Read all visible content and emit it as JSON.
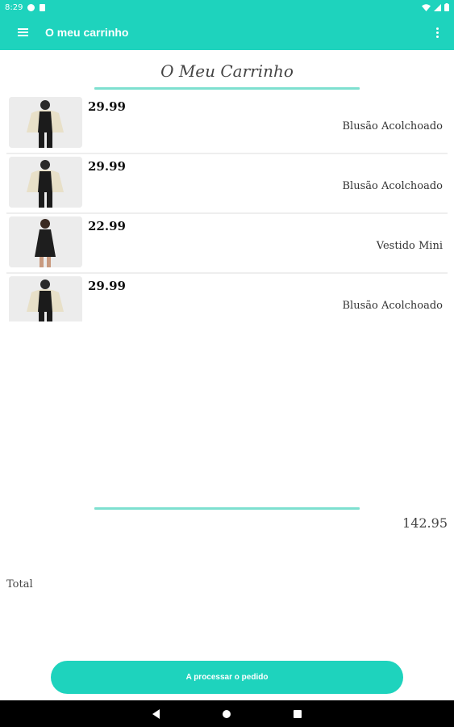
{
  "status_bar": {
    "time": "8:29",
    "icons": [
      "notification-icon",
      "sd-card-icon",
      "wifi-icon",
      "signal-icon",
      "battery-icon"
    ]
  },
  "app_bar": {
    "title": "O meu carrinho",
    "menu_icon": "hamburger-menu-icon",
    "overflow_icon": "more-vertical-icon"
  },
  "page": {
    "heading": "O Meu Carrinho"
  },
  "cart": {
    "items": [
      {
        "price": "29.99",
        "name": "Blusão Acolchoado",
        "image": "puffer-jacket"
      },
      {
        "price": "29.99",
        "name": "Blusão Acolchoado",
        "image": "puffer-jacket"
      },
      {
        "price": "22.99",
        "name": "Vestido Mini",
        "image": "mini-dress"
      },
      {
        "price": "29.99",
        "name": "Blusão Acolchoado",
        "image": "puffer-jacket"
      }
    ]
  },
  "summary": {
    "total_value": "142.95",
    "total_label": "Total"
  },
  "checkout": {
    "label": "A processar o pedido"
  },
  "colors": {
    "accent": "#1ed3bd",
    "divider": "#7ee0d0"
  }
}
